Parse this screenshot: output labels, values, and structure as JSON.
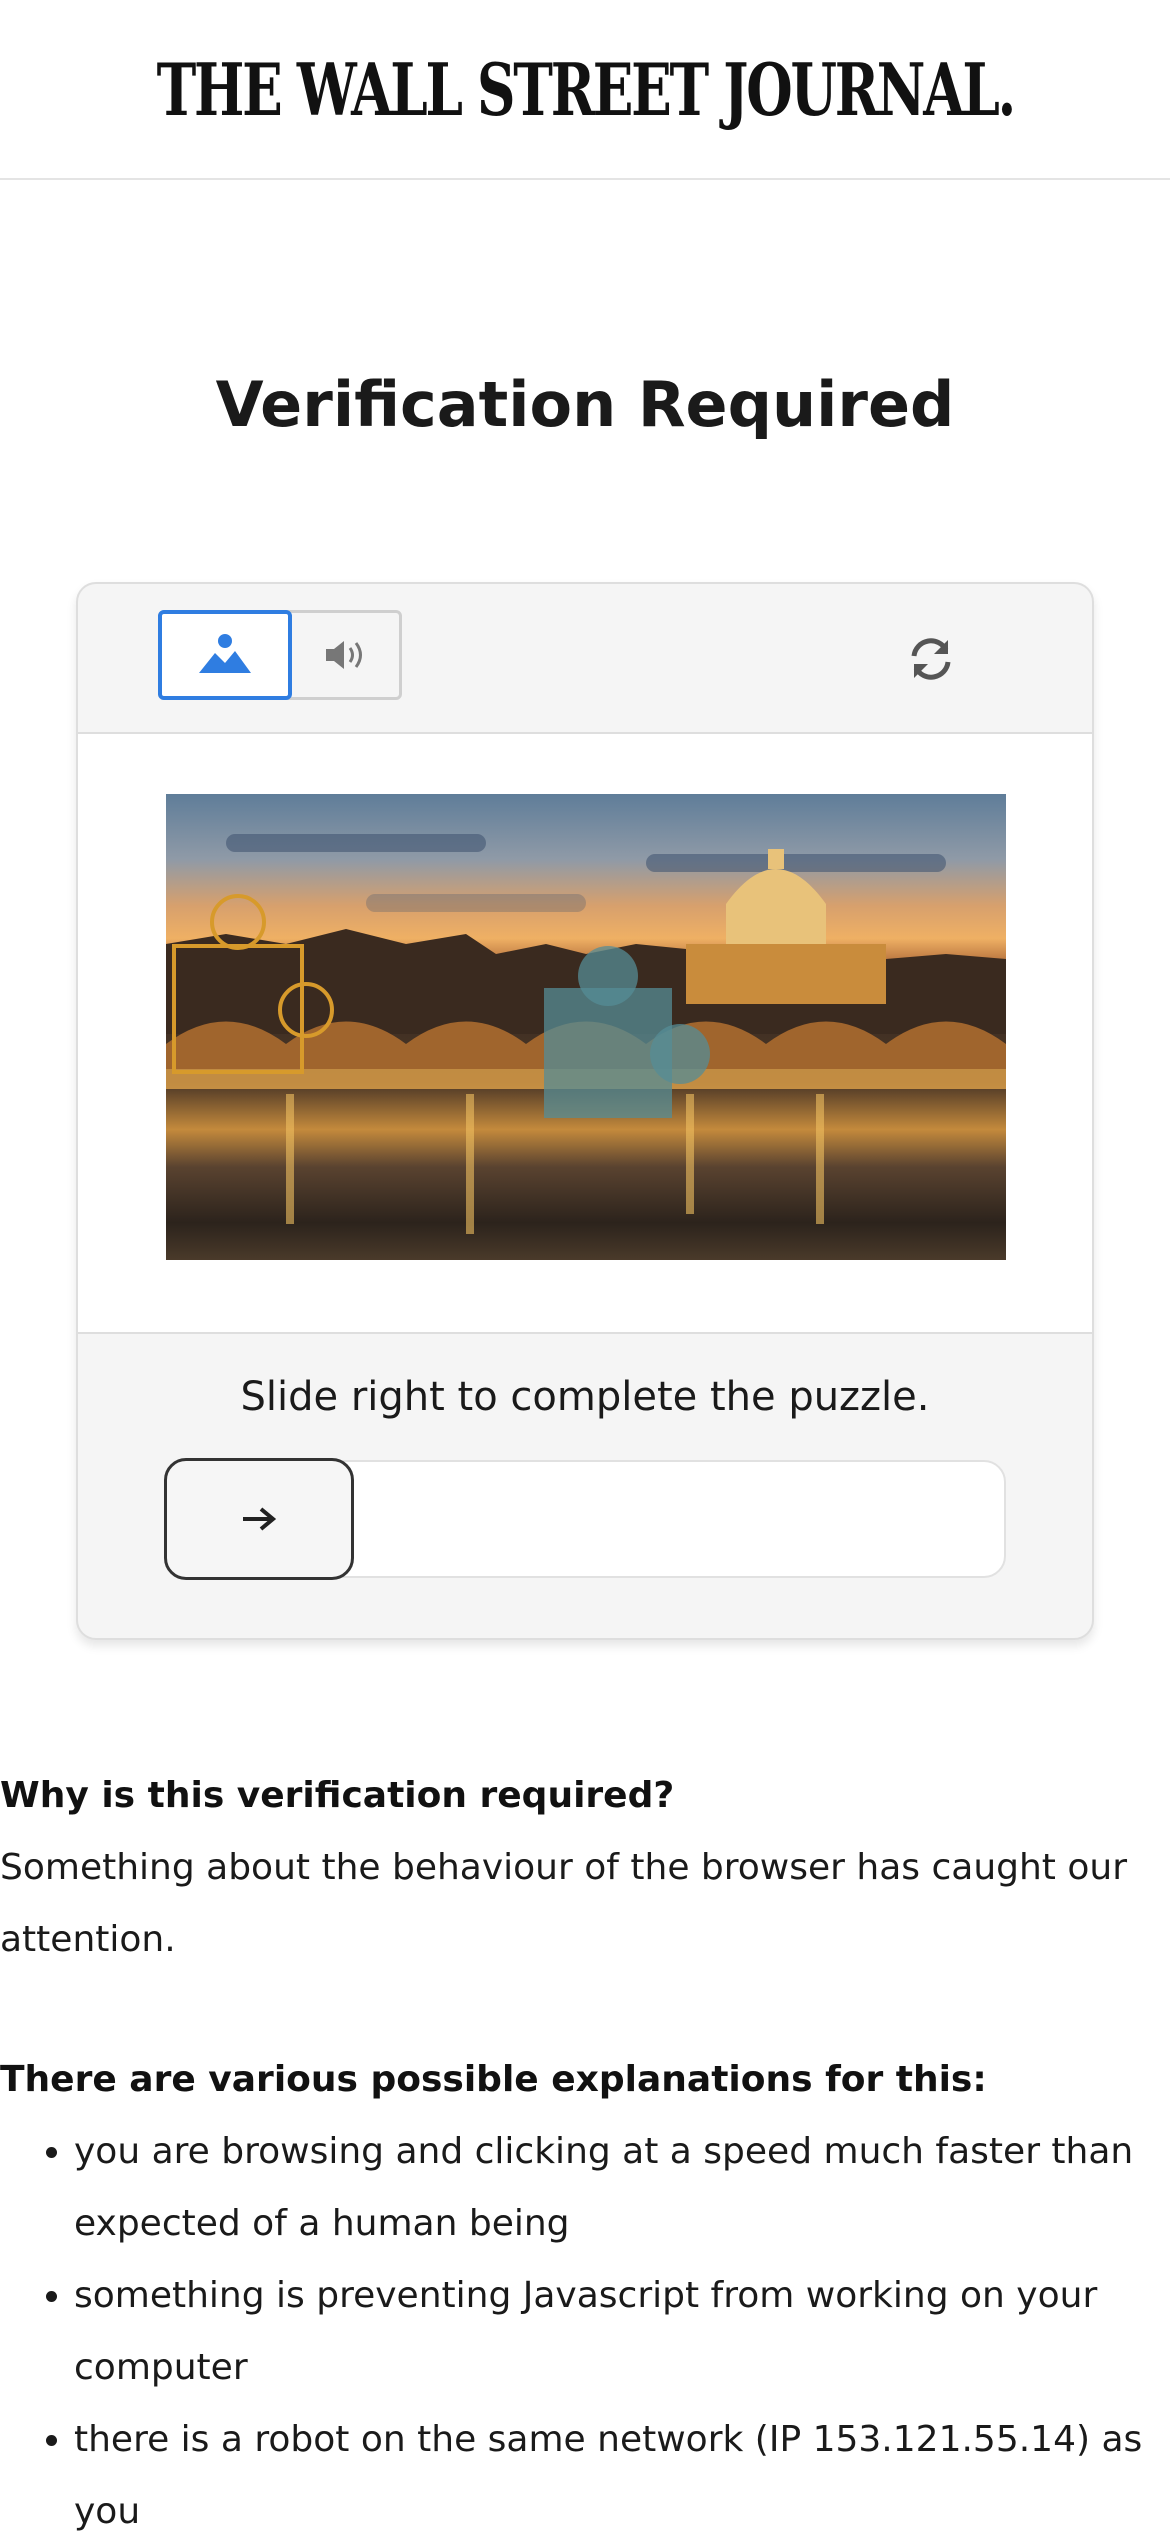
{
  "header": {
    "logo_text": "THE WALL STREET JOURNAL."
  },
  "page": {
    "title": "Verification Required"
  },
  "captcha": {
    "modes": {
      "image_icon": "image-mountain-icon",
      "audio_icon": "speaker-icon",
      "active": "image"
    },
    "refresh_icon": "refresh-icon",
    "instruction": "Slide right to complete the puzzle.",
    "slider": {
      "handle_icon": "arrow-right-icon",
      "progress": 0
    },
    "accent_color": "#2f7de1"
  },
  "info": {
    "why_heading": "Why is this verification required?",
    "why_text": "Something about the behaviour of the browser has caught our attention.",
    "reasons_heading": "There are various possible explanations for this:",
    "reasons": [
      "you are browsing and clicking at a speed much faster than expected of a human being",
      "something is preventing Javascript from working on your computer",
      "there is a robot on the same network (IP 153.121.55.14) as you"
    ]
  }
}
